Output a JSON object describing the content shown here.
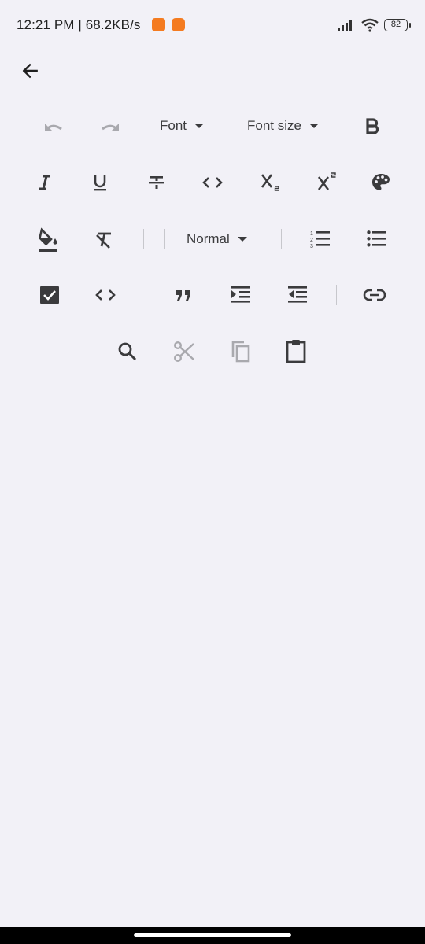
{
  "status_bar": {
    "text": "12:21 PM | 68.2KB/s",
    "battery": "82"
  },
  "toolbar": {
    "font_dropdown": "Font",
    "font_size_dropdown": "Font size",
    "heading_dropdown": "Normal"
  },
  "colors": {
    "background": "#f2f1f7",
    "icon": "#3b3b3d",
    "disabled_icon": "#a9a9ae",
    "badge": "#f47b20"
  }
}
